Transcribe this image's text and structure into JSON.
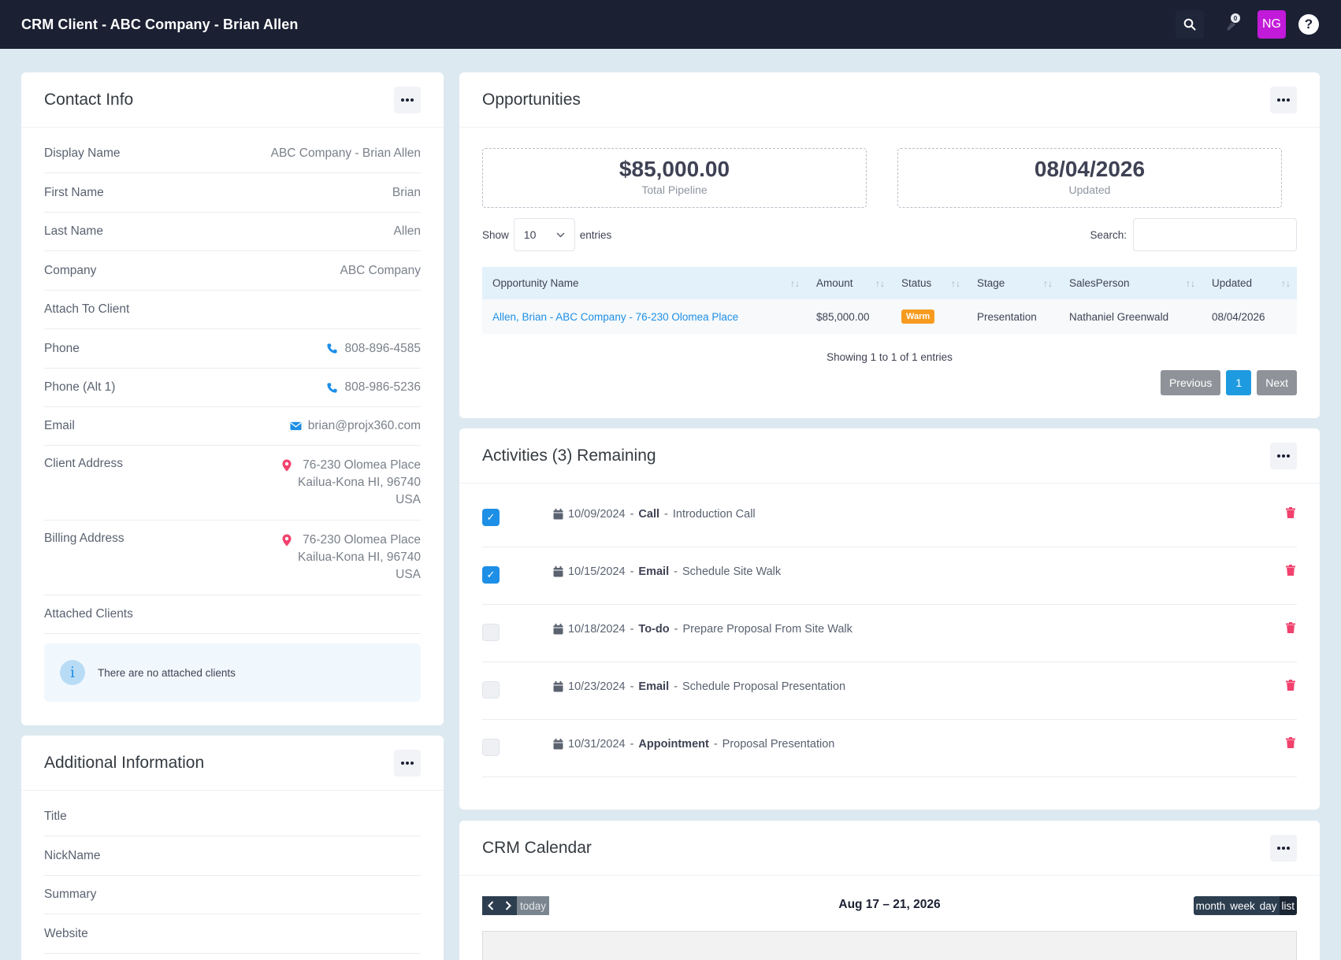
{
  "header": {
    "title": "CRM Client - ABC Company - Brian Allen",
    "notification_count": "0",
    "avatar_initials": "NG",
    "help_label": "?"
  },
  "contact_info": {
    "title": "Contact Info",
    "rows": [
      {
        "label": "Display Name",
        "value": "ABC Company - Brian Allen"
      },
      {
        "label": "First Name",
        "value": "Brian"
      },
      {
        "label": "Last Name",
        "value": "Allen"
      },
      {
        "label": "Company",
        "value": "ABC Company"
      },
      {
        "label": "Attach To Client",
        "value": ""
      },
      {
        "label": "Phone",
        "value": "808-896-4585"
      },
      {
        "label": "Phone (Alt 1)",
        "value": "808-986-5236"
      },
      {
        "label": "Email",
        "value": "brian@projx360.com"
      }
    ],
    "client_address": {
      "label": "Client Address",
      "line1": "76-230 Olomea Place",
      "line2": "Kailua-Kona HI, 96740",
      "line3": "USA"
    },
    "billing_address": {
      "label": "Billing Address",
      "line1": "76-230 Olomea Place",
      "line2": "Kailua-Kona HI, 96740",
      "line3": "USA"
    },
    "attached_clients": {
      "label": "Attached Clients",
      "empty_message": "There are no attached clients",
      "info_icon": "i"
    }
  },
  "additional_info": {
    "title": "Additional Information",
    "rows": [
      {
        "label": "Title"
      },
      {
        "label": "NickName"
      },
      {
        "label": "Summary"
      },
      {
        "label": "Website"
      }
    ]
  },
  "opportunities": {
    "title": "Opportunities",
    "total_pipeline": {
      "value": "$85,000.00",
      "label": "Total Pipeline"
    },
    "updated": {
      "value": "08/04/2026",
      "label": "Updated"
    },
    "show_label": "Show",
    "entries_select": "10",
    "entries_label": "entries",
    "search_label": "Search:",
    "columns": [
      "Opportunity Name",
      "Amount",
      "Status",
      "Stage",
      "SalesPerson",
      "Updated"
    ],
    "rows": [
      {
        "name": "Allen, Brian - ABC Company - 76-230 Olomea Place",
        "amount": "$85,000.00",
        "status": "Warm",
        "stage": "Presentation",
        "salesperson": "Nathaniel Greenwald",
        "updated": "08/04/2026"
      }
    ],
    "showing_text": "Showing 1 to 1 of 1 entries",
    "pager": {
      "previous": "Previous",
      "page": "1",
      "next": "Next"
    }
  },
  "activities": {
    "title": "Activities (3) Remaining",
    "items": [
      {
        "checked": true,
        "date": "10/09/2024",
        "type": "Call",
        "desc": "Introduction Call"
      },
      {
        "checked": true,
        "date": "10/15/2024",
        "type": "Email",
        "desc": "Schedule Site Walk"
      },
      {
        "checked": false,
        "date": "10/18/2024",
        "type": "To-do",
        "desc": "Prepare Proposal From Site Walk"
      },
      {
        "checked": false,
        "date": "10/23/2024",
        "type": "Email",
        "desc": "Schedule Proposal Presentation"
      },
      {
        "checked": false,
        "date": "10/31/2024",
        "type": "Appointment",
        "desc": "Proposal Presentation"
      }
    ],
    "separator": "-"
  },
  "calendar": {
    "title": "CRM Calendar",
    "today_label": "today",
    "range": "Aug 17 – 21, 2026",
    "views": [
      "month",
      "week",
      "day",
      "list"
    ],
    "active_view": "list"
  },
  "colors": {
    "topbar": "#1b2033",
    "accent": "#1e8fe6",
    "warm_badge": "#f69b1f",
    "avatar": "#c21ad9",
    "danger": "#f1416c"
  }
}
